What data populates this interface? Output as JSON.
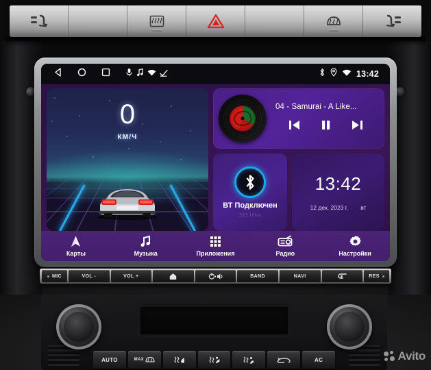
{
  "top_panel": {
    "buttons": [
      {
        "name": "seat-heater-left",
        "icon": "seat-heater-icon",
        "label": ""
      },
      {
        "name": "blank-left",
        "icon": "",
        "label": ""
      },
      {
        "name": "rear-defrost",
        "icon": "rear-defrost-icon",
        "label": ""
      },
      {
        "name": "hazard-lights",
        "icon": "hazard-triangle-icon",
        "label": ""
      },
      {
        "name": "blank-right",
        "icon": "",
        "label": ""
      },
      {
        "name": "front-defrost",
        "icon": "windshield-defrost-icon",
        "label": ""
      },
      {
        "name": "seat-heater-right",
        "icon": "seat-heater-icon",
        "label": ""
      }
    ]
  },
  "statusbar": {
    "nav": [
      {
        "name": "back-icon",
        "label": "back"
      },
      {
        "name": "home-icon",
        "label": "home"
      },
      {
        "name": "recents-icon",
        "label": "recents"
      }
    ],
    "indicators": [
      {
        "name": "mic-icon"
      },
      {
        "name": "music-note-icon"
      },
      {
        "name": "wifi-icon"
      },
      {
        "name": "signal-check-icon"
      }
    ],
    "right_icons": [
      {
        "name": "bluetooth-icon"
      },
      {
        "name": "location-icon"
      },
      {
        "name": "wifi-icon"
      }
    ],
    "clock": "13:42"
  },
  "speedometer": {
    "value": "0",
    "unit": "КМ/Ч"
  },
  "music": {
    "track_title": "04 - Samurai - A Like...",
    "controls": [
      {
        "name": "previous-track-button",
        "glyph": "prev"
      },
      {
        "name": "pause-button",
        "glyph": "pause"
      },
      {
        "name": "next-track-button",
        "glyph": "next"
      }
    ]
  },
  "bluetooth": {
    "status": "ВТ Подключен",
    "device": "S22 Ultra"
  },
  "clock_widget": {
    "time": "13:42",
    "date": "12 дек. 2023 г.",
    "weekday": "вт"
  },
  "dock": {
    "items": [
      {
        "label": "Карты",
        "icon": "navigation-arrow-icon"
      },
      {
        "label": "Музыка",
        "icon": "music-note-icon"
      },
      {
        "label": "Приложения",
        "icon": "apps-grid-icon"
      },
      {
        "label": "Радио",
        "icon": "radio-icon"
      },
      {
        "label": "Настройки",
        "icon": "gear-icon"
      }
    ]
  },
  "hardware_buttons": [
    {
      "label": "MIC",
      "icon": "mic-dot-icon"
    },
    {
      "label": "VOL -",
      "icon": ""
    },
    {
      "label": "VOL +",
      "icon": ""
    },
    {
      "label": "",
      "icon": "home-house-icon"
    },
    {
      "label": "",
      "icon": "power-mute-icon"
    },
    {
      "label": "BAND",
      "icon": ""
    },
    {
      "label": "NAVI",
      "icon": ""
    },
    {
      "label": "",
      "icon": "back-arrow-icon"
    },
    {
      "label": "RES",
      "icon": "reset-dot-icon"
    }
  ],
  "climate": {
    "buttons": [
      {
        "label": "AUTO",
        "icon": ""
      },
      {
        "label": "MAX",
        "icon": "max-defrost-icon"
      },
      {
        "label": "",
        "icon": "air-face-icon"
      },
      {
        "label": "",
        "icon": "air-body-icon"
      },
      {
        "label": "",
        "icon": "air-feet-icon"
      },
      {
        "label": "",
        "icon": "recirculation-icon"
      },
      {
        "label": "AC",
        "icon": ""
      }
    ]
  },
  "watermark": {
    "text": "Avito"
  },
  "colors": {
    "accent_purple": "#4b2277",
    "bluetooth_blue": "#1ea7e8",
    "lane_blue": "#29a8e8",
    "hazard_red": "#e02020",
    "screen_bg": "#0a0a12"
  }
}
